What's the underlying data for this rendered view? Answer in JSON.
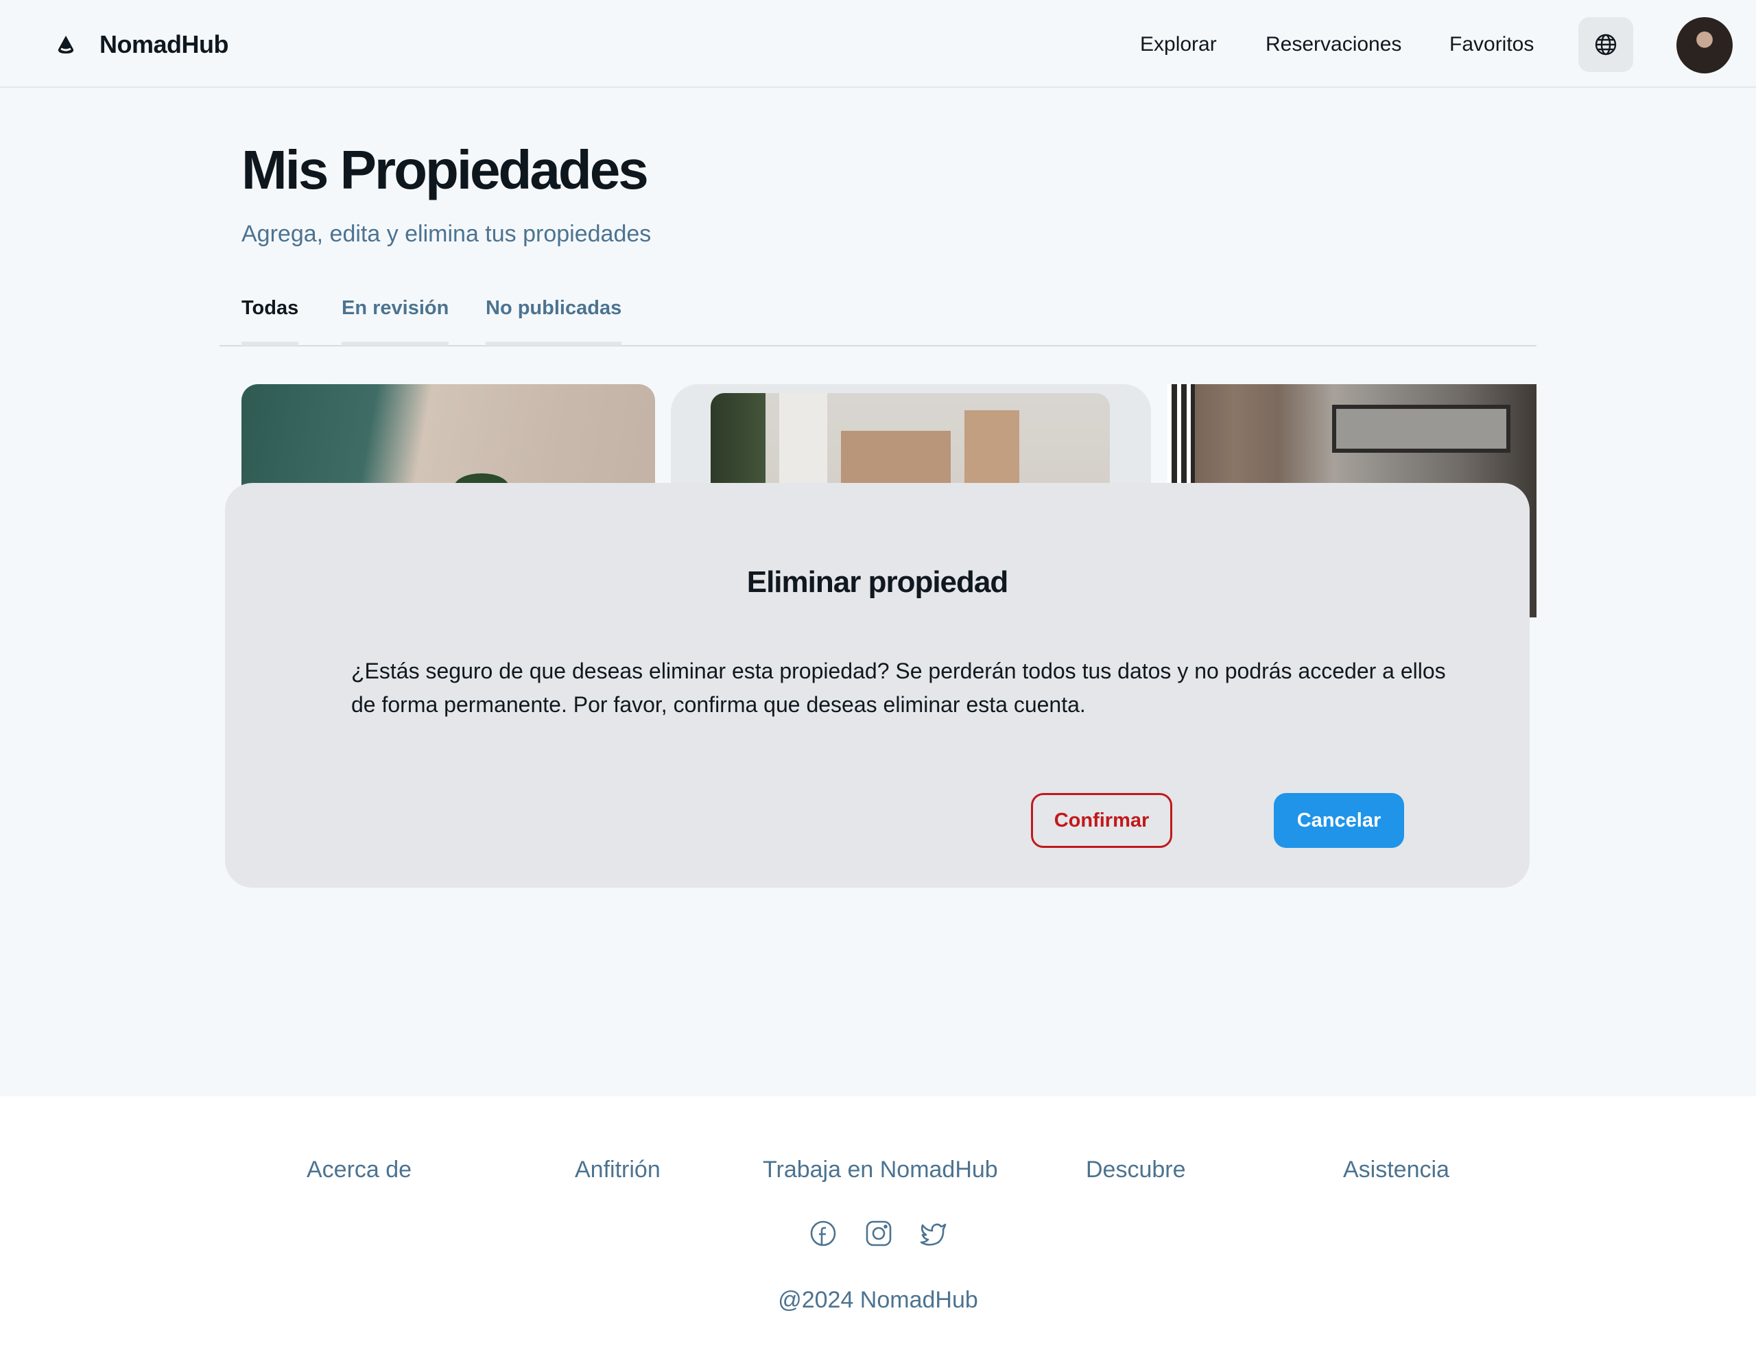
{
  "header": {
    "brand": "NomadHub",
    "nav": [
      "Explorar",
      "Reservaciones",
      "Favoritos"
    ],
    "icons": {
      "logo": "logo-drop-icon",
      "language": "globe-icon",
      "avatar": "user-avatar"
    }
  },
  "page": {
    "title": "Mis Propiedades",
    "subtitle": "Agrega, edita y elimina tus propiedades",
    "tabs": [
      "Todas",
      "En revisión",
      "No publicadas"
    ],
    "active_tab": "Todas"
  },
  "modal": {
    "title": "Eliminar propiedad",
    "message": "¿Estás seguro de que deseas eliminar esta propiedad? Se perderán todos tus datos y no podrás acceder a ellos de forma permanente. Por favor, confirma que deseas eliminar esta cuenta.",
    "confirm_label": "Confirmar",
    "cancel_label": "Cancelar"
  },
  "footer": {
    "links": [
      "Acerca de",
      "Anfitrión",
      "Trabaja en NomadHub",
      "Descubre",
      "Asistencia"
    ],
    "social_icons": [
      "facebook-icon",
      "instagram-icon",
      "twitter-icon"
    ],
    "copyright": "@2024 NomadHub"
  },
  "colors": {
    "background": "#f5f8fb",
    "accent_blue": "#1f94e8",
    "danger_red": "#c0191c",
    "muted_text": "#4c7390"
  }
}
